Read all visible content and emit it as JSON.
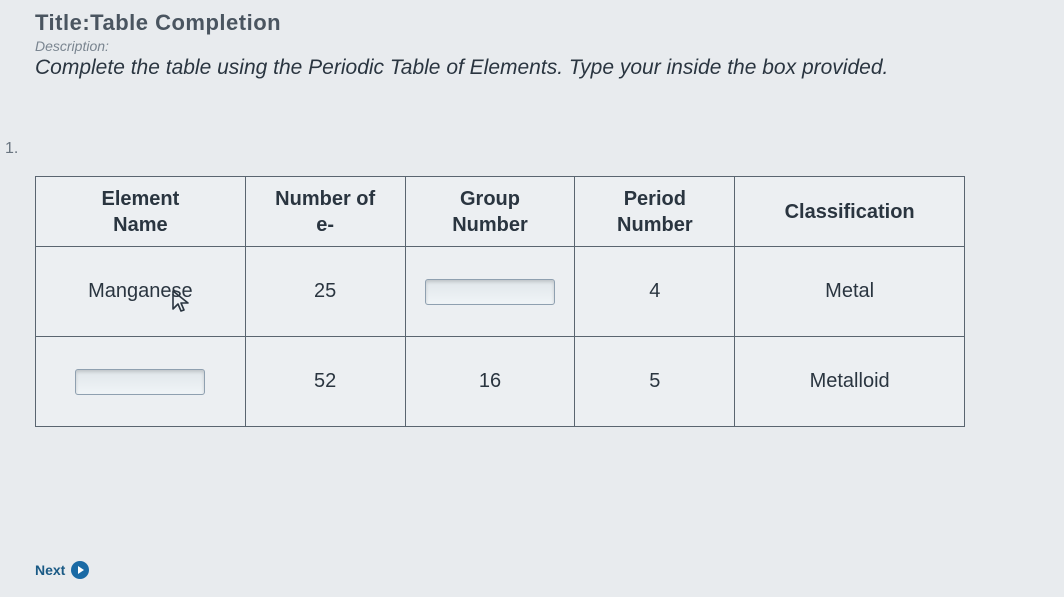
{
  "title_label": "Title:",
  "title_value": "Table Completion",
  "description_label": "Description:",
  "description_text": "Complete the table using the Periodic Table of Elements. Type your inside the box provided.",
  "question_number": "1.",
  "table": {
    "headers": {
      "element": "Element Name",
      "num_e": "Number of e-",
      "group": "Group Number",
      "period": "Period Number",
      "classification": "Classification"
    },
    "rows": [
      {
        "element": "Manganese",
        "num_e": "25",
        "group": "",
        "period": "4",
        "classification": "Metal",
        "input_col": "group"
      },
      {
        "element": "",
        "num_e": "52",
        "group": "16",
        "period": "5",
        "classification": "Metalloid",
        "input_col": "element"
      }
    ]
  },
  "next_label": "Next"
}
